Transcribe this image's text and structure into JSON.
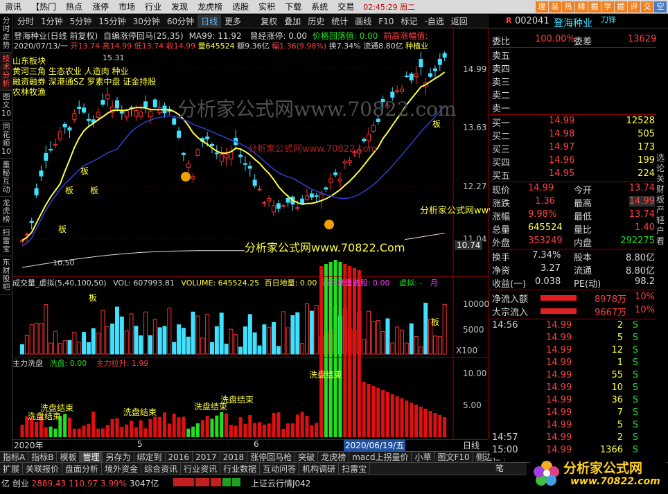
{
  "menu": {
    "items": [
      "资讯",
      "【热门",
      "热点",
      "涨停",
      "市场",
      "行业",
      "发现",
      "龙虎榜",
      "选股",
      "实积",
      "下载",
      "系统",
      "交易"
    ],
    "time": "02:45:29 周二",
    "right_buttons": [
      "理",
      "装",
      "热",
      "精",
      "掘",
      "学",
      "掘",
      "评",
      "交",
      "空"
    ]
  },
  "toolbar": {
    "items": [
      "分时",
      "1分钟",
      "5分钟",
      "15分钟",
      "30分钟",
      "60分钟",
      "日线",
      "更多",
      "复权",
      "叠加",
      "历史",
      "统计",
      "画线",
      "F10",
      "标记",
      "-自选",
      "返回"
    ],
    "selected": "日线"
  },
  "left_tabs": [
    "分时走势",
    "技术分析",
    "图文10",
    "同花顺10",
    "董秘互动",
    "龙虎榜",
    "扫雷宝",
    "东财股吧"
  ],
  "chart": {
    "header_line1": "登海种业(日线 前复权)",
    "indicator_name": "自编涨停回马(25,35)",
    "ma_text": "MA99: 11.92",
    "zt_text": "曾经涨停: 0.00",
    "hd_text": "价格回落值: 0.00",
    "qg_text": "前高涨幅值:",
    "date_line": "2020/07/13/一",
    "ohlc": {
      "open": "开13.74",
      "high": "高14.99",
      "low": "低13.74",
      "close": "收14.99",
      "vol": "量645524",
      "amt": "额9.36亿",
      "chg": "幅1.36(9.98%)",
      "turn": "换7.34%",
      "float": "流通8.80亿",
      "industry": "种植业"
    },
    "blocks": [
      "山东板块",
      "黄河三角 生态农业 人造肉 种业",
      "融资融券 深港通SZ 罗素中盘 证金持股",
      "农林牧渔"
    ],
    "price_labels": [
      "14.99",
      "13.63",
      "12.27",
      "11.04",
      "10.74"
    ],
    "high_mark": "15.31",
    "low_mark": "10.50",
    "watermark": "分析家公式网www.70822.com",
    "watermark2": "分析家公式网www.70822.com",
    "watermark3": "分析家公式网www.70822.Com",
    "watermark4": "分析家公式网www.70822.Com",
    "ban": "板"
  },
  "volume_panel": {
    "header": "成交量_虚拟(5,40,100,50)",
    "vol": "VOL: 607993.81",
    "volume": "VOLUME: 645524.25",
    "bdl": "百日地量: 0.00",
    "bdlxg": "百日地量选股: 0.00",
    "xn": "虚拟: -",
    "month": "月",
    "labels": [
      "10000",
      "5000",
      "X100"
    ],
    "ban": "板"
  },
  "wash_panel": {
    "title": "主力洗盘",
    "xp": "洗盘: 0.00",
    "ls": "主力拉升: 1.99",
    "labels": [
      "10.00",
      "5.00"
    ],
    "tag": "洗盘结束"
  },
  "time_axis": [
    "2020年",
    "5",
    "6",
    "2020/06/19/五",
    "日线"
  ],
  "bottom_tabs": [
    "扩展",
    "关联报价",
    "盘面分析",
    "境外资金",
    "综合资讯",
    "行业资讯",
    "行业数据",
    "互动问答",
    "机构调研",
    "扫雷宝"
  ],
  "bottom_tabs2": [
    "指标A",
    "指标B",
    "模板",
    "管理",
    "另存为",
    "绑定到",
    "2016",
    "2017",
    "2018",
    "涨停回马枪",
    "突破",
    "龙虎榜",
    "macd上拐量价",
    "小草",
    "图文F10",
    "侧边栏"
  ],
  "status": {
    "line1": "亿  创业",
    "cy_value": "2889.43",
    "cy_chg": "110.97",
    "cy_pct": "3.99%",
    "cy_amt": "3047亿",
    "sh_text": "上证云行情J042"
  },
  "quote": {
    "code": "002041",
    "name": "登海种业",
    "tag": "刀锋",
    "wb_label": "委比",
    "wb": "100.00%",
    "wc_label": "委差",
    "wc": "13629",
    "sells": [
      "卖五",
      "卖四",
      "卖三",
      "卖二",
      "卖一"
    ],
    "buys": [
      {
        "label": "买一",
        "price": "14.99",
        "vol": "12528"
      },
      {
        "label": "买二",
        "price": "14.98",
        "vol": "505"
      },
      {
        "label": "买三",
        "price": "14.97",
        "vol": "173"
      },
      {
        "label": "买四",
        "price": "14.96",
        "vol": "199"
      },
      {
        "label": "买五",
        "price": "14.95",
        "vol": "224"
      }
    ],
    "stats": [
      {
        "l1": "现价",
        "v1": "14.99",
        "l2": "今开",
        "v2": "13.74"
      },
      {
        "l1": "涨跌",
        "v1": "1.36",
        "l2": "最高",
        "v2": "14.99"
      },
      {
        "l1": "涨幅",
        "v1": "9.98%",
        "l2": "最低",
        "v2": "13.74"
      },
      {
        "l1": "总量",
        "v1": "645524",
        "l2": "量比",
        "v2": "1.40"
      },
      {
        "l1": "外盘",
        "v1": "353249",
        "l2": "内盘",
        "v2": "292275"
      }
    ],
    "stats2": [
      {
        "l1": "换手",
        "v1": "7.34%",
        "l2": "股本",
        "v2": "8.80亿"
      },
      {
        "l1": "净资",
        "v1": "3.27",
        "l2": "流通",
        "v2": "8.80亿"
      },
      {
        "l1": "收益(一)",
        "v1": "0.038",
        "l2": "PE(动)",
        "v2": "98.2"
      }
    ],
    "flows": [
      {
        "label": "净流入额",
        "value": "8978万",
        "pct": "10%"
      },
      {
        "label": "大宗流入",
        "value": "9667万",
        "pct": "10%"
      }
    ],
    "ticks": [
      {
        "time": "14:56",
        "price": "14.99",
        "vol": "2",
        "dir": "S"
      },
      {
        "time": "",
        "price": "14.99",
        "vol": "5",
        "dir": "S"
      },
      {
        "time": "",
        "price": "14.99",
        "vol": "12",
        "dir": "S"
      },
      {
        "time": "",
        "price": "14.99",
        "vol": "1",
        "dir": "S"
      },
      {
        "time": "",
        "price": "14.99",
        "vol": "55",
        "dir": "S"
      },
      {
        "time": "",
        "price": "14.99",
        "vol": "10",
        "dir": "S"
      },
      {
        "time": "",
        "price": "14.99",
        "vol": "36",
        "dir": "S"
      },
      {
        "time": "",
        "price": "14.99",
        "vol": "7",
        "dir": "S"
      },
      {
        "time": "",
        "price": "14.99",
        "vol": "5",
        "dir": "S"
      },
      {
        "time": "14:57",
        "price": "14.99",
        "vol": "2",
        "dir": "S"
      },
      {
        "time": "15:00",
        "price": "14.99",
        "vol": "1366",
        "dir": "S"
      }
    ],
    "right_vert": [
      "选",
      "论",
      "关",
      "财",
      "板",
      "产",
      "轻",
      "户",
      "看"
    ],
    "bottom_btn": "笔"
  },
  "logo": {
    "text": "分析家公式网",
    "url": "www.70822.com"
  }
}
